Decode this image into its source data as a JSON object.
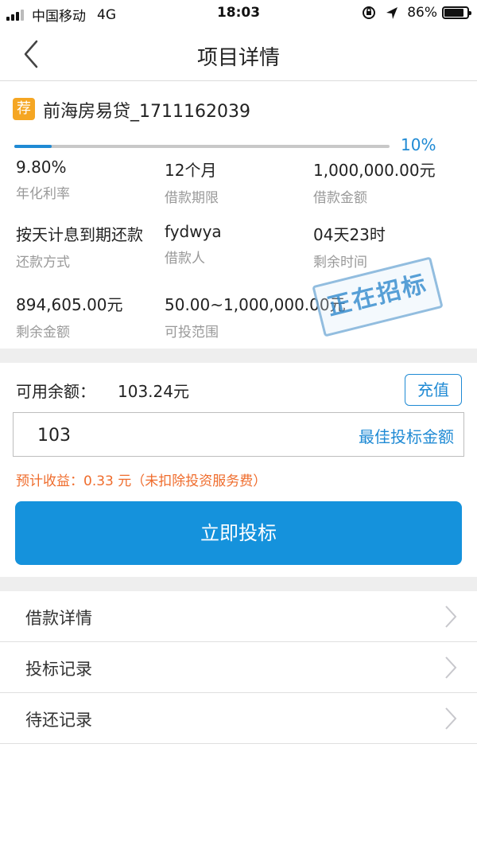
{
  "status_bar": {
    "carrier": "中国移动",
    "network": "4G",
    "time": "18:03",
    "battery": "86%",
    "battery_level": 0.86
  },
  "nav": {
    "title": "项目详情"
  },
  "project": {
    "badge": "荐",
    "name": "前海房易贷_1711162039",
    "progress_text": "10%",
    "progress_value": 0.1,
    "fields": [
      {
        "value": "9.80%",
        "label": "年化利率"
      },
      {
        "value": "12个月",
        "label": "借款期限"
      },
      {
        "value": "1,000,000.00元",
        "label": "借款金额"
      },
      {
        "value": "按天计息到期还款",
        "label": "还款方式"
      },
      {
        "value": "fydwya",
        "label": "借款人"
      },
      {
        "value": "04天23时",
        "label": "剩余时间"
      },
      {
        "value": "894,605.00元",
        "label": "剩余金额"
      },
      {
        "value": "50.00~1,000,000.00元",
        "label": "可投范围"
      }
    ],
    "stamp": "正在招标"
  },
  "invest": {
    "balance_label": "可用余额：",
    "balance_value": "103.24元",
    "recharge_label": "充值",
    "amount_value": "103",
    "best_amount_label": "最佳投标金额",
    "expected_text": "预计收益：0.33 元（未扣除投资服务费）",
    "bid_label": "立即投标"
  },
  "menu": [
    {
      "label": "借款详情"
    },
    {
      "label": "投标记录"
    },
    {
      "label": "待还记录"
    }
  ],
  "colors": {
    "accent": "#1f8ad4",
    "button": "#1592dc",
    "badge": "#f5a623",
    "warning_text": "#ef6c2c"
  }
}
